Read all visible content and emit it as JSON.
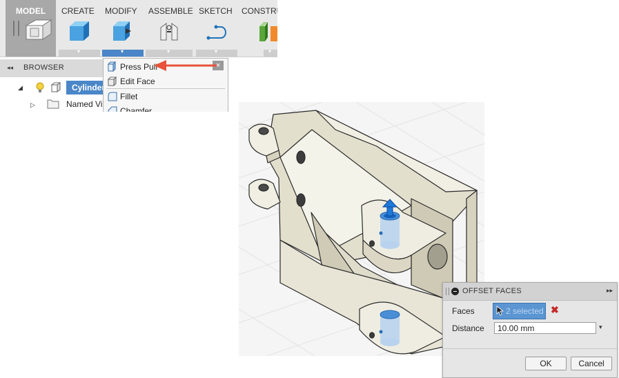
{
  "ribbon": {
    "workspace_label": "MODEL",
    "tabs": [
      {
        "label": "CREATE"
      },
      {
        "label": "MODIFY",
        "active": true
      },
      {
        "label": "ASSEMBLE"
      },
      {
        "label": "SKETCH"
      },
      {
        "label": "CONSTRU"
      }
    ],
    "dropdown_glyph": "▾"
  },
  "browser": {
    "title": "BROWSER",
    "collapse_glyph": "◂◂",
    "items": [
      {
        "label": "Cylinder",
        "selected": true
      },
      {
        "label": "Named Vi"
      }
    ]
  },
  "modify_menu": {
    "close_glyph": "×",
    "items": [
      {
        "label": "Press Pull",
        "icon": "press-pull-icon"
      },
      {
        "label": "Edit Face",
        "icon": "edit-face-icon"
      },
      {
        "label": "Fillet",
        "icon": "fillet-icon"
      },
      {
        "label": "Chamfer",
        "icon": "chamfer-icon"
      }
    ]
  },
  "annotation": {
    "arrow_color": "#e8513a"
  },
  "offset_faces_dialog": {
    "title": "OFFSET FACES",
    "expand_glyph": "▸▸",
    "faces_label": "Faces",
    "faces_value": "2 selected",
    "clear_glyph": "✖",
    "distance_label": "Distance",
    "distance_value": "10.00 mm",
    "dropdown_glyph": "▾",
    "ok_label": "OK",
    "cancel_label": "Cancel"
  },
  "colors": {
    "accent": "#4a86c8",
    "part_body": "#ebe8d9",
    "selection_face": "#4a8fd6"
  }
}
